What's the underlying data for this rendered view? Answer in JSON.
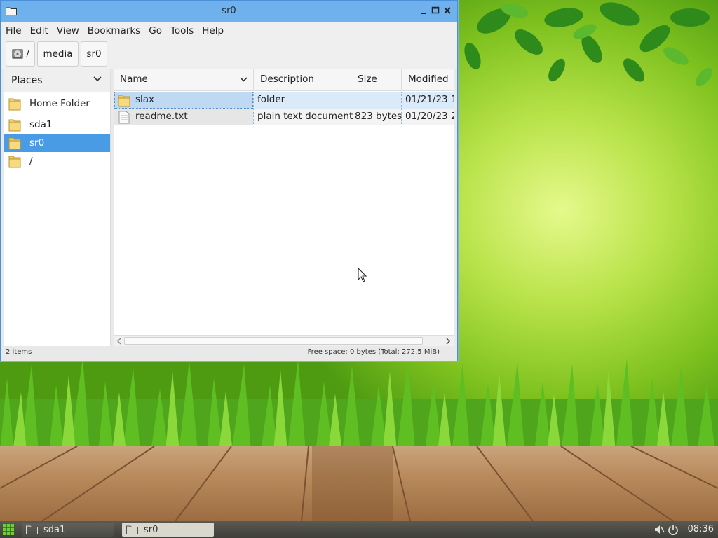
{
  "window": {
    "title": "sr0",
    "menu": [
      "File",
      "Edit",
      "View",
      "Bookmarks",
      "Go",
      "Tools",
      "Help"
    ],
    "breadcrumbs": [
      "/",
      "media",
      "sr0"
    ]
  },
  "sidebar": {
    "header": "Places",
    "items": [
      {
        "label": "Home Folder",
        "icon": "folder-icon"
      },
      {
        "label": "sda1",
        "icon": "folder-icon"
      },
      {
        "label": "sr0",
        "icon": "folder-icon",
        "selected": true
      },
      {
        "label": "/",
        "icon": "folder-icon"
      }
    ]
  },
  "files": {
    "columns": [
      "Name",
      "Description",
      "Size",
      "Modified"
    ],
    "rows": [
      {
        "name": "slax",
        "description": "folder",
        "size": "",
        "modified": "01/21/23 1",
        "icon": "folder-icon",
        "selected": true
      },
      {
        "name": "readme.txt",
        "description": "plain text document",
        "size": "823 bytes",
        "modified": "01/20/23 2",
        "icon": "text-file-icon"
      }
    ]
  },
  "status": {
    "items": "2 items",
    "free_space": "Free space: 0 bytes (Total: 272.5 MiB)"
  },
  "taskbar": {
    "tasks": [
      "sda1",
      "sr0"
    ],
    "clock": "08:36"
  },
  "colors": {
    "titlebar": "#6fb1ec",
    "selection": "#4a9be6",
    "row_highlight": "#cfe3f7"
  }
}
